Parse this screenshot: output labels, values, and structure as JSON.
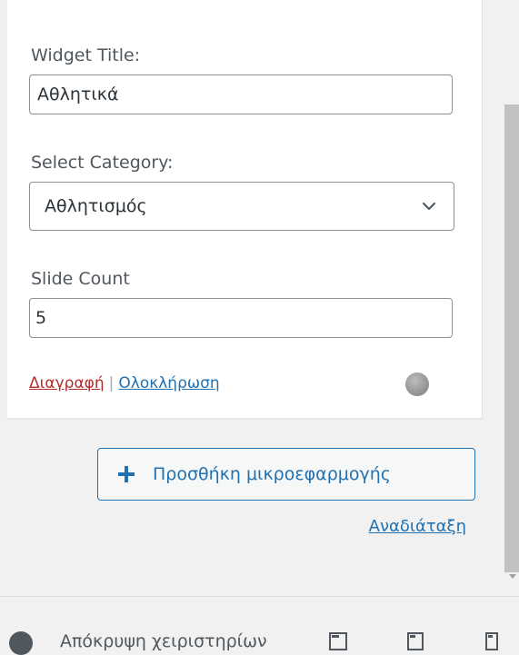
{
  "widget_form": {
    "title_label": "Widget Title:",
    "title_value": "Αθλητικά",
    "category_label": "Select Category:",
    "category_value": "Αθλητισμός",
    "slide_count_label": "Slide Count",
    "slide_count_value": "5"
  },
  "widget_actions": {
    "delete_label": "Διαγραφή",
    "separator": "|",
    "done_label": "Ολοκλήρωση"
  },
  "add_widget": {
    "label": "Προσθήκη μικροεφαρμογής",
    "icon": "plus-icon"
  },
  "reorder_label": "Αναδιάταξη",
  "footer": {
    "collapse_label": "Απόκρυψη χειριστηρίων",
    "icons": [
      "collapse-icon",
      "desktop-preview-icon",
      "tablet-preview-icon",
      "mobile-preview-icon"
    ]
  },
  "colors": {
    "link": "#2271b1",
    "delete": "#b32d2e",
    "background": "#f1f1f1"
  }
}
